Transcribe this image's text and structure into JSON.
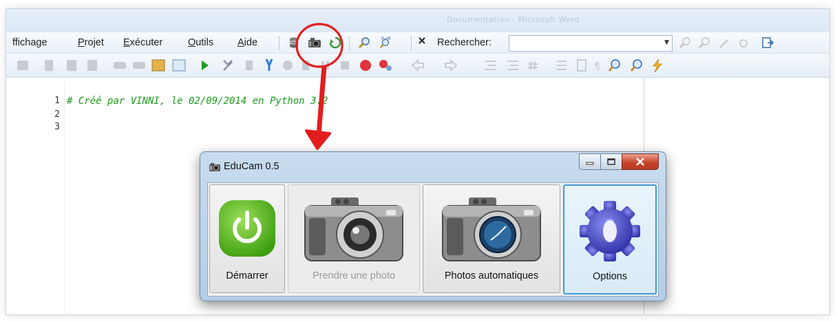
{
  "window": {
    "title": "Documentation - Microsoft Word"
  },
  "menu": {
    "items": [
      {
        "prefix": "",
        "underline": "",
        "rest": "ffichage"
      },
      {
        "prefix": "",
        "underline": "P",
        "rest": "rojet"
      },
      {
        "prefix": "",
        "underline": "E",
        "rest": "xécuter"
      },
      {
        "prefix": "",
        "underline": "O",
        "rest": "utils"
      },
      {
        "prefix": "",
        "underline": "A",
        "rest": "ide"
      }
    ]
  },
  "search": {
    "label": "Rechercher:",
    "value": ""
  },
  "editor": {
    "line_numbers": [
      "1",
      "2",
      "3"
    ],
    "code": "# Créé par VINNI, le 02/09/2014 en Python 3.2"
  },
  "dialog": {
    "title": "EduCam 0.5",
    "buttons": {
      "start": "Démarrer",
      "photo": "Prendre une photo",
      "auto": "Photos automatiques",
      "options": "Options"
    }
  },
  "colors": {
    "accent": "#3c9ad7",
    "annotation": "#e31d1d",
    "code": "#1a9c1a",
    "power": "#5cbf1f"
  },
  "icons": [
    "close-x-icon",
    "search-icon",
    "camera-icon",
    "power-icon",
    "gear-icon",
    "run-icon",
    "stop-icon"
  ]
}
